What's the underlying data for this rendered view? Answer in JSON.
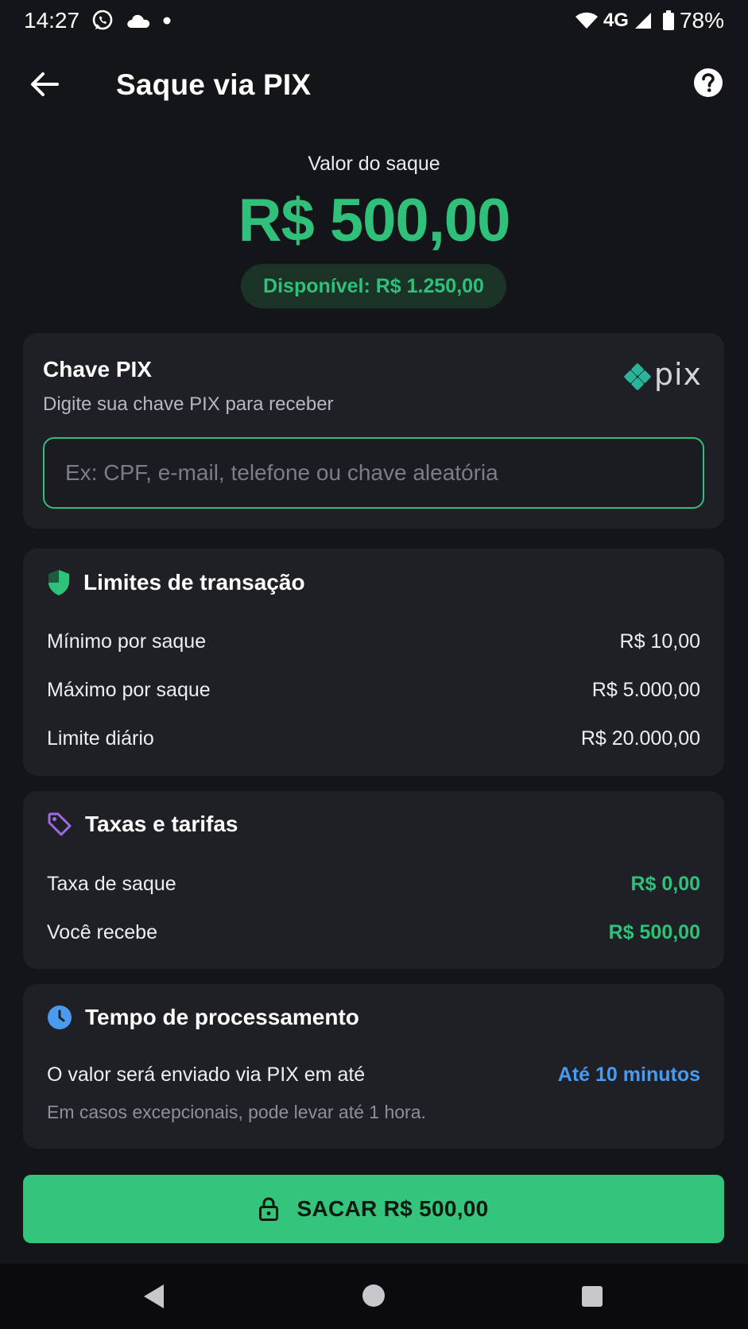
{
  "status_bar": {
    "time": "14:27",
    "icons": [
      "whatsapp-icon",
      "cloud-icon",
      "dot-icon",
      "wifi-icon",
      "signal-icon",
      "battery-icon"
    ],
    "network": "4G",
    "battery": "78%"
  },
  "app_bar": {
    "title": "Saque via PIX",
    "back_icon": "arrow-left-icon",
    "help_icon": "help-circle-icon"
  },
  "amount": {
    "label": "Valor do saque",
    "value": "R$ 500,00",
    "available": "Disponível: R$ 1.250,00"
  },
  "pix_key": {
    "title": "Chave PIX",
    "subtitle": "Digite sua chave PIX para receber",
    "logo_text": "pix",
    "input_value": "",
    "input_placeholder": "Ex: CPF, e-mail, telefone ou chave aleatória"
  },
  "limits": {
    "title": "Limites de transação",
    "rows": [
      {
        "label": "Mínimo por saque",
        "value": "R$ 10,00"
      },
      {
        "label": "Máximo por saque",
        "value": "R$ 5.000,00"
      },
      {
        "label": "Limite diário",
        "value": "R$ 20.000,00"
      }
    ]
  },
  "fees": {
    "title": "Taxas e tarifas",
    "rows": [
      {
        "label": "Taxa de saque",
        "value": "R$ 0,00"
      },
      {
        "label": "Você recebe",
        "value": "R$ 500,00"
      }
    ]
  },
  "processing": {
    "title": "Tempo de processamento",
    "label": "O valor será enviado via PIX em até",
    "value": "Até 10 minutos",
    "note": "Em casos excepcionais, pode levar até 1 hora."
  },
  "action": {
    "label": "SACAR R$ 500,00"
  },
  "colors": {
    "background": "#141519",
    "card": "#1e2026",
    "accent_green": "#2fc07a",
    "button_green": "#34c47c",
    "accent_blue": "#4a9bef",
    "accent_purple": "#9b6be0"
  }
}
